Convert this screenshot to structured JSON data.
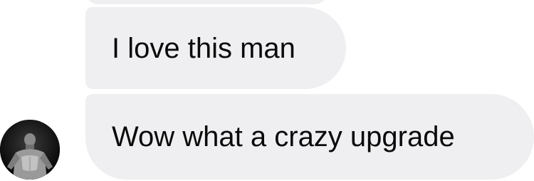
{
  "messages": [
    {
      "text": "I love this man"
    },
    {
      "text": "Wow what a crazy upgrade"
    }
  ],
  "colors": {
    "bubble_bg": "#efeff1",
    "text": "#0a0a0a",
    "background": "#ffffff"
  },
  "icons": {
    "avatar": "profile-photo-avatar-icon"
  }
}
